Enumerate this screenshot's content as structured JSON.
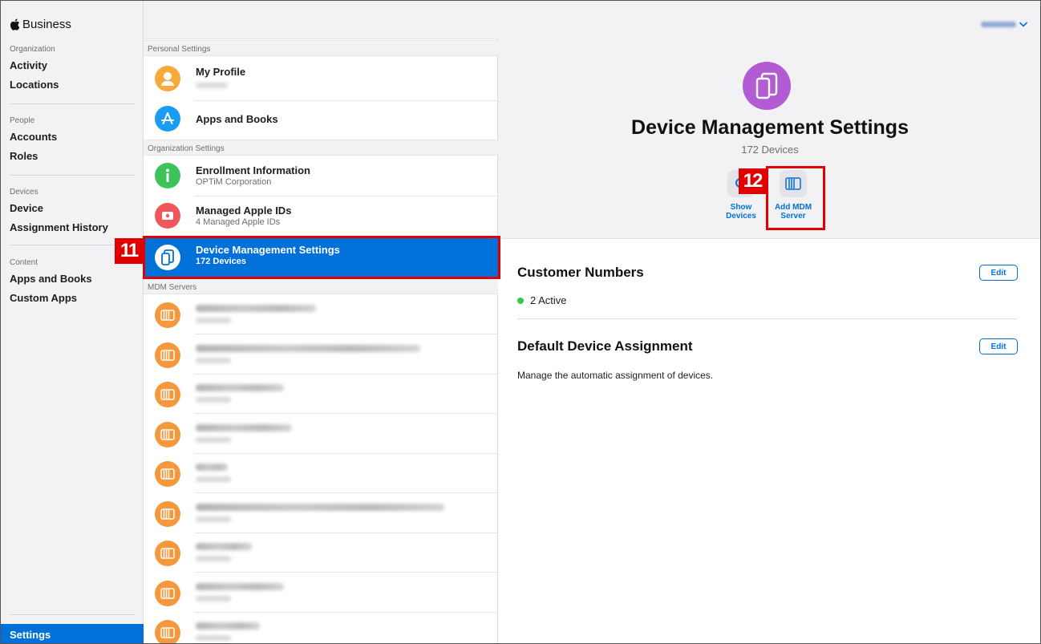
{
  "app": {
    "brand": "Business"
  },
  "sidebar": {
    "groups": [
      {
        "title": "Organization",
        "items": [
          "Activity",
          "Locations"
        ]
      },
      {
        "title": "People",
        "items": [
          "Accounts",
          "Roles"
        ]
      },
      {
        "title": "Devices",
        "items": [
          "Device",
          "Assignment History"
        ]
      },
      {
        "title": "Content",
        "items": [
          "Apps and Books",
          "Custom Apps"
        ]
      }
    ],
    "settings": "Settings"
  },
  "middle": {
    "personal_header": "Personal Settings",
    "my_profile": {
      "title": "My Profile"
    },
    "apps_books": {
      "title": "Apps and Books"
    },
    "org_header": "Organization Settings",
    "enrollment": {
      "title": "Enrollment Information",
      "subtitle": "OPTiM Corporation"
    },
    "managed_ids": {
      "title": "Managed Apple IDs",
      "subtitle": "4 Managed Apple IDs"
    },
    "device_mgmt": {
      "title": "Device Management Settings",
      "subtitle": "172 Devices"
    },
    "mdm_header": "MDM Servers"
  },
  "detail": {
    "title": "Device Management Settings",
    "subtitle": "172 Devices",
    "show_devices": "Show Devices",
    "add_mdm_server": "Add MDM Server",
    "customer_numbers": {
      "title": "Customer Numbers",
      "edit": "Edit",
      "status": "2 Active"
    },
    "default_assignment": {
      "title": "Default Device Assignment",
      "edit": "Edit",
      "description": "Manage the automatic assignment of devices."
    }
  },
  "annotations": {
    "step11": "11",
    "step12": "12"
  },
  "colors": {
    "accent": "#0071d8",
    "selection": "#0071d8",
    "annotation": "#e00000",
    "device_icon": "#b25bd3",
    "mdm_icon": "#f5973b",
    "active_status": "#34c759"
  }
}
